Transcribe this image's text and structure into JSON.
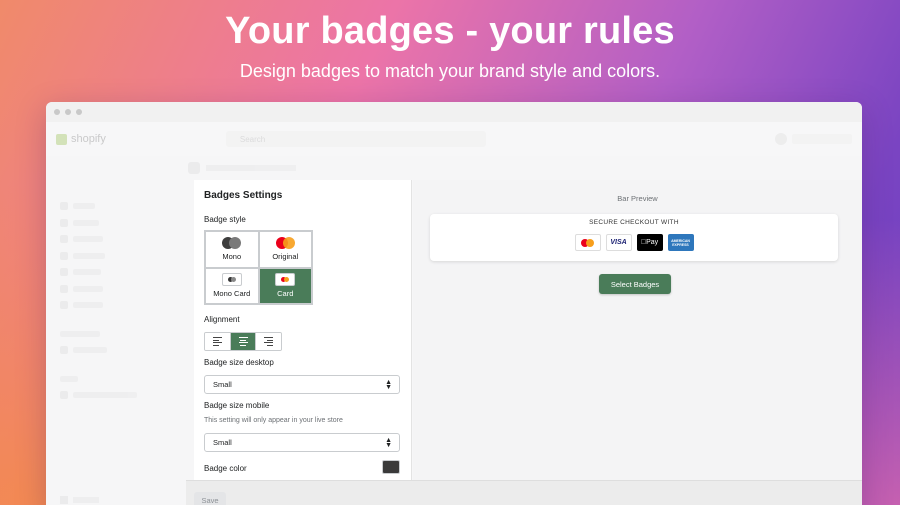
{
  "hero": {
    "title": "Your badges - your rules",
    "subtitle": "Design badges to match your brand style and colors."
  },
  "shopify_chrome": {
    "logo": "shopify",
    "search_placeholder": "Search"
  },
  "settings": {
    "section_title": "Badges Settings",
    "badge_style_label": "Badge style",
    "styles": [
      {
        "label": "Mono",
        "selected": false
      },
      {
        "label": "Original",
        "selected": false
      },
      {
        "label": "Mono Card",
        "selected": false
      },
      {
        "label": "Card",
        "selected": true
      }
    ],
    "alignment_label": "Alignment",
    "alignment_selected": "center",
    "size_desktop_label": "Badge size desktop",
    "size_desktop_value": "Small",
    "size_mobile_label": "Badge size mobile",
    "size_mobile_help": "This setting will only appear in your live store",
    "size_mobile_value": "Small",
    "badge_color_label": "Badge color",
    "badge_color_value": "#3a3a3a"
  },
  "preview": {
    "label": "Bar Preview",
    "bar_title": "SECURE CHECKOUT WITH",
    "badges": [
      {
        "name": "mastercard-icon"
      },
      {
        "name": "visa-icon",
        "text": "VISA"
      },
      {
        "name": "apple-pay-icon",
        "text": "Pay"
      },
      {
        "name": "amex-icon",
        "text": "AMERICAN EXPRESS"
      }
    ],
    "select_button": "Select Badges"
  },
  "savebar": {
    "save_label": "Save"
  },
  "colors": {
    "accent": "#4a7c59"
  }
}
